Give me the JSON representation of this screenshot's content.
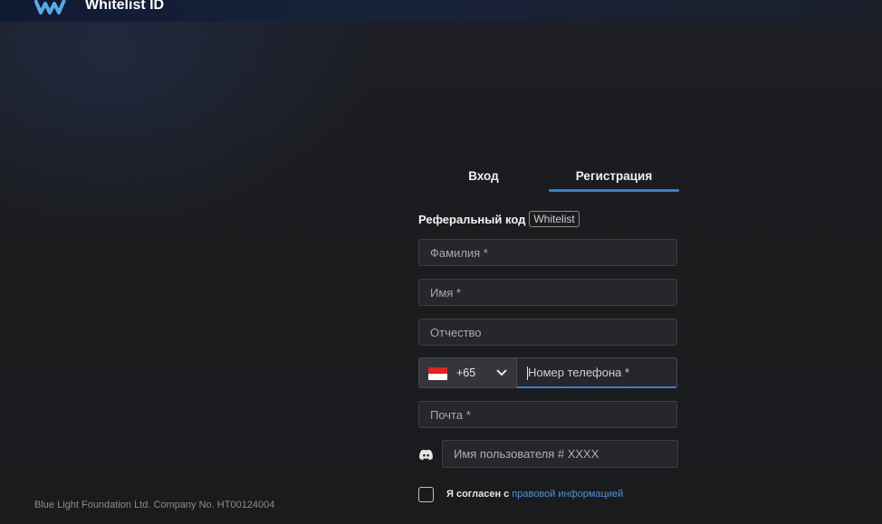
{
  "header": {
    "brand": "Whitelist ID",
    "logo_icon": "whitelist-logo-icon"
  },
  "tabs": [
    {
      "label": "Вход",
      "active": false
    },
    {
      "label": "Регистрация",
      "active": true
    }
  ],
  "referral": {
    "label": "Реферальный код",
    "code": "Whitelist"
  },
  "form": {
    "last_name_placeholder": "Фамилия *",
    "first_name_placeholder": "Имя *",
    "middle_name_placeholder": "Отчество",
    "phone": {
      "country_flag": "singapore-flag-icon",
      "dial_code": "+65",
      "placeholder": "Номер телефона *"
    },
    "email_placeholder": "Почта *",
    "discord": {
      "icon": "discord-icon",
      "placeholder": "Имя пользователя # XXXX"
    },
    "consent": {
      "checked": false,
      "text": "Я согласен с",
      "link": "правовой информацией"
    }
  },
  "footer": {
    "company": "Blue Light Foundation Ltd. Company No. HT00124004"
  },
  "colors": {
    "accent": "#3c7fd0",
    "link": "#4f8fdc",
    "background": "#1b1c1f",
    "field": "#26272a"
  }
}
